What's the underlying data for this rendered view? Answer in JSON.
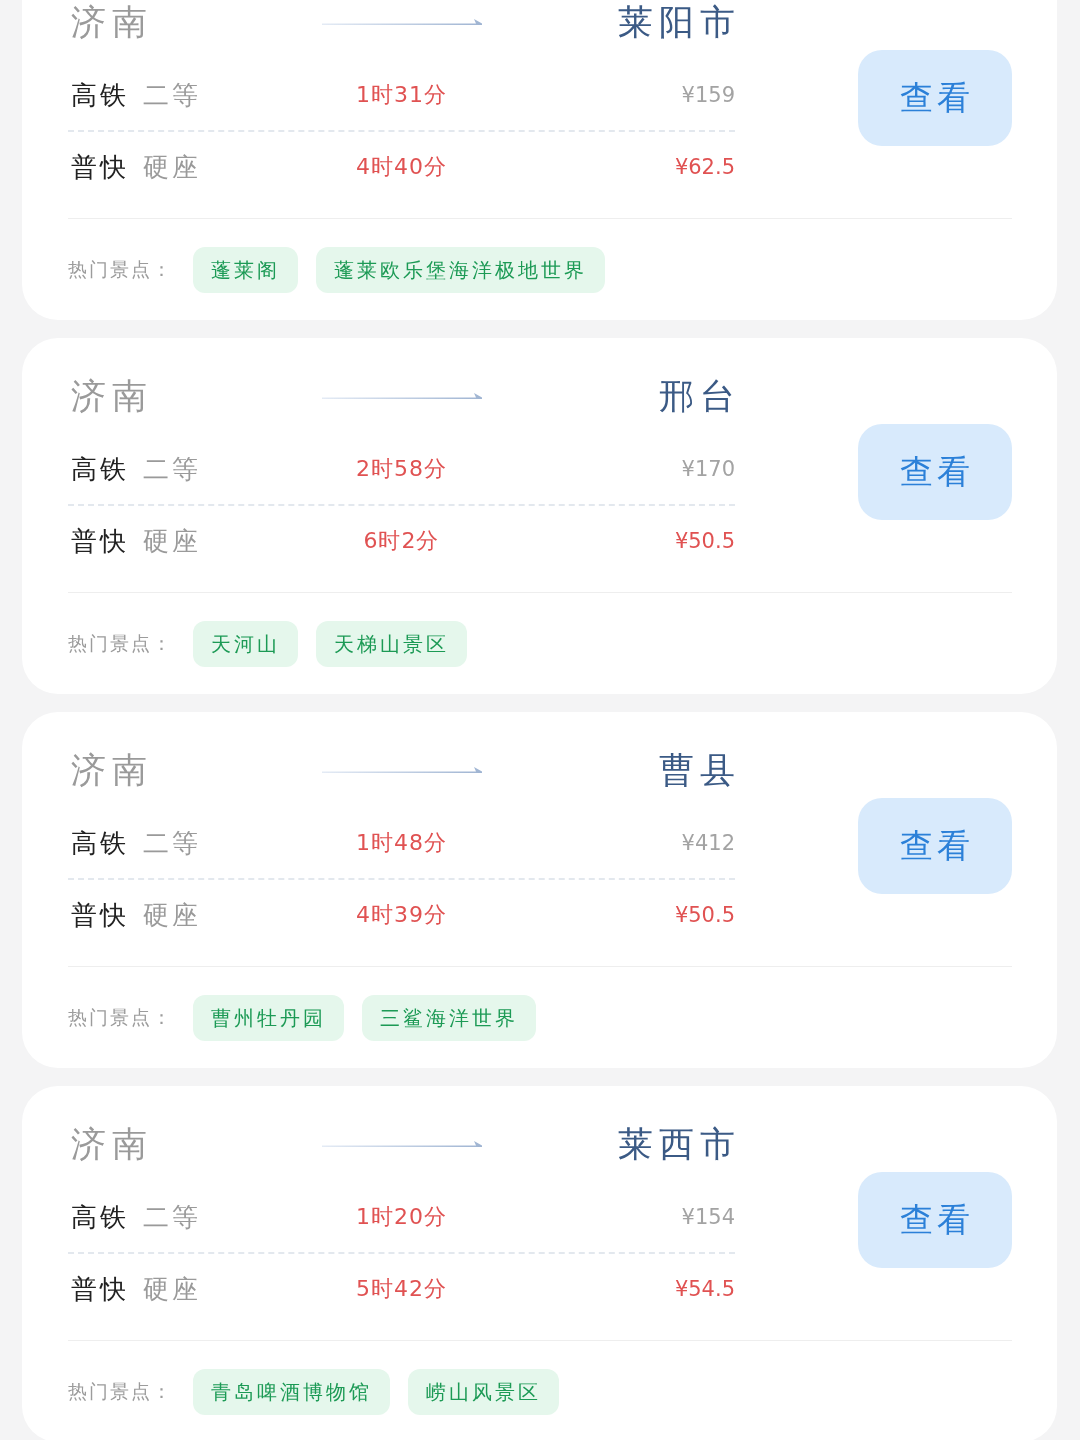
{
  "routes": [
    {
      "origin": "济南",
      "destination": "莱阳市",
      "options": [
        {
          "train": "高铁",
          "seat": "二等",
          "duration": "1时31分",
          "price": "¥159",
          "highlighted": false
        },
        {
          "train": "普快",
          "seat": "硬座",
          "duration": "4时40分",
          "price": "¥62.5",
          "highlighted": true
        }
      ],
      "attractions_label": "热门景点：",
      "attractions": [
        "蓬莱阁",
        "蓬莱欧乐堡海洋极地世界"
      ],
      "button": "查看"
    },
    {
      "origin": "济南",
      "destination": "邢台",
      "options": [
        {
          "train": "高铁",
          "seat": "二等",
          "duration": "2时58分",
          "price": "¥170",
          "highlighted": false
        },
        {
          "train": "普快",
          "seat": "硬座",
          "duration": "6时2分",
          "price": "¥50.5",
          "highlighted": true
        }
      ],
      "attractions_label": "热门景点：",
      "attractions": [
        "天河山",
        "天梯山景区"
      ],
      "button": "查看"
    },
    {
      "origin": "济南",
      "destination": "曹县",
      "options": [
        {
          "train": "高铁",
          "seat": "二等",
          "duration": "1时48分",
          "price": "¥412",
          "highlighted": false
        },
        {
          "train": "普快",
          "seat": "硬座",
          "duration": "4时39分",
          "price": "¥50.5",
          "highlighted": true
        }
      ],
      "attractions_label": "热门景点：",
      "attractions": [
        "曹州牡丹园",
        "三鲨海洋世界"
      ],
      "button": "查看"
    },
    {
      "origin": "济南",
      "destination": "莱西市",
      "options": [
        {
          "train": "高铁",
          "seat": "二等",
          "duration": "1时20分",
          "price": "¥154",
          "highlighted": false
        },
        {
          "train": "普快",
          "seat": "硬座",
          "duration": "5时42分",
          "price": "¥54.5",
          "highlighted": true
        }
      ],
      "attractions_label": "热门景点：",
      "attractions": [
        "青岛啤酒博物馆",
        "崂山风景区"
      ],
      "button": "查看"
    }
  ]
}
